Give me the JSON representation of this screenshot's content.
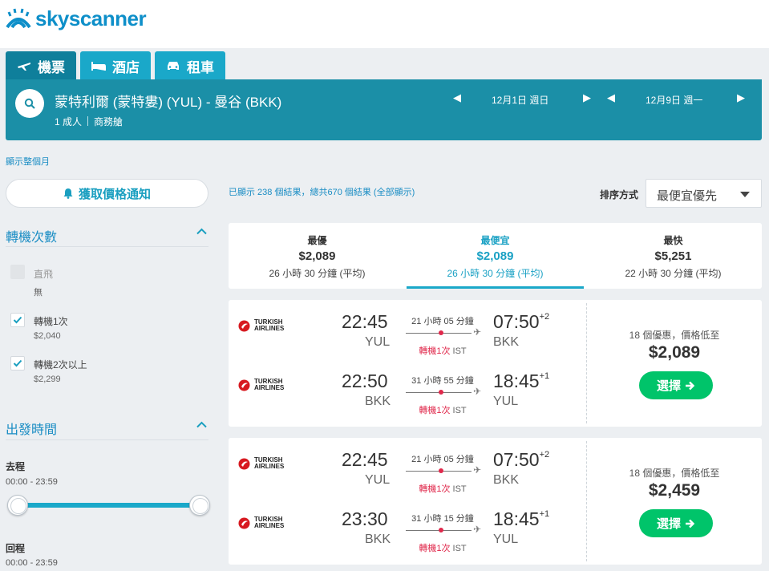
{
  "brand": {
    "name": "skyscanner",
    "color": "#0e8fc9"
  },
  "tabs": [
    {
      "label": "機票",
      "icon": "plane-icon",
      "active": true
    },
    {
      "label": "酒店",
      "icon": "bed-icon",
      "active": false
    },
    {
      "label": "租車",
      "icon": "car-icon",
      "active": false
    }
  ],
  "search": {
    "route": "蒙特利爾 (蒙特婁) (YUL) - 曼谷 (BKK)",
    "passengers": "1 成人",
    "cabin": "商務艙",
    "depart_date": "12月1日 週日",
    "return_date": "12月9日 週一"
  },
  "show_month": "顯示整個月",
  "price_alert_label": "獲取價格通知",
  "filters": {
    "stops": {
      "title": "轉機次數",
      "options": [
        {
          "label": "直飛",
          "sub": "無",
          "checked": false
        },
        {
          "label": "轉機1次",
          "sub": "$2,040",
          "checked": true
        },
        {
          "label": "轉機2次以上",
          "sub": "$2,299",
          "checked": true
        }
      ]
    },
    "departure_times": {
      "title": "出發時間",
      "outbound_label": "去程",
      "outbound_range": "00:00 - 23:59",
      "inbound_label": "回程",
      "inbound_range": "00:00 - 23:59"
    }
  },
  "results_count": "已顯示 238 個結果，總共670 個結果 (全部顯示)",
  "sort": {
    "label": "排序方式",
    "value": "最便宜優先"
  },
  "summary": [
    {
      "title": "最優",
      "price": "$2,089",
      "duration": "26 小時 30 分鐘 (平均)",
      "active": false
    },
    {
      "title": "最便宜",
      "price": "$2,089",
      "duration": "26 小時 30 分鐘 (平均)",
      "active": true
    },
    {
      "title": "最快",
      "price": "$5,251",
      "duration": "22 小時 30 分鐘 (平均)",
      "active": false
    }
  ],
  "results": [
    {
      "legs": [
        {
          "airline": [
            "TURKISH",
            "AIRLINES"
          ],
          "dep_time": "22:45",
          "dep_airport": "YUL",
          "duration": "21 小時 05 分鐘",
          "stops": "轉機1次",
          "via": "IST",
          "arr_time": "07:50",
          "arr_offset": "+2",
          "arr_airport": "BKK"
        },
        {
          "airline": [
            "TURKISH",
            "AIRLINES"
          ],
          "dep_time": "22:50",
          "dep_airport": "BKK",
          "duration": "31 小時 55 分鐘",
          "stops": "轉機1次",
          "via": "IST",
          "arr_time": "18:45",
          "arr_offset": "+1",
          "arr_airport": "YUL"
        }
      ],
      "deals": "18 個優惠，價格低至",
      "price": "$2,089",
      "select_label": "選擇"
    },
    {
      "legs": [
        {
          "airline": [
            "TURKISH",
            "AIRLINES"
          ],
          "dep_time": "22:45",
          "dep_airport": "YUL",
          "duration": "21 小時 05 分鐘",
          "stops": "轉機1次",
          "via": "IST",
          "arr_time": "07:50",
          "arr_offset": "+2",
          "arr_airport": "BKK"
        },
        {
          "airline": [
            "TURKISH",
            "AIRLINES"
          ],
          "dep_time": "23:30",
          "dep_airport": "BKK",
          "duration": "31 小時 15 分鐘",
          "stops": "轉機1次",
          "via": "IST",
          "arr_time": "18:45",
          "arr_offset": "+1",
          "arr_airport": "YUL"
        }
      ],
      "deals": "18 個優惠，價格低至",
      "price": "$2,459",
      "select_label": "選擇"
    }
  ]
}
